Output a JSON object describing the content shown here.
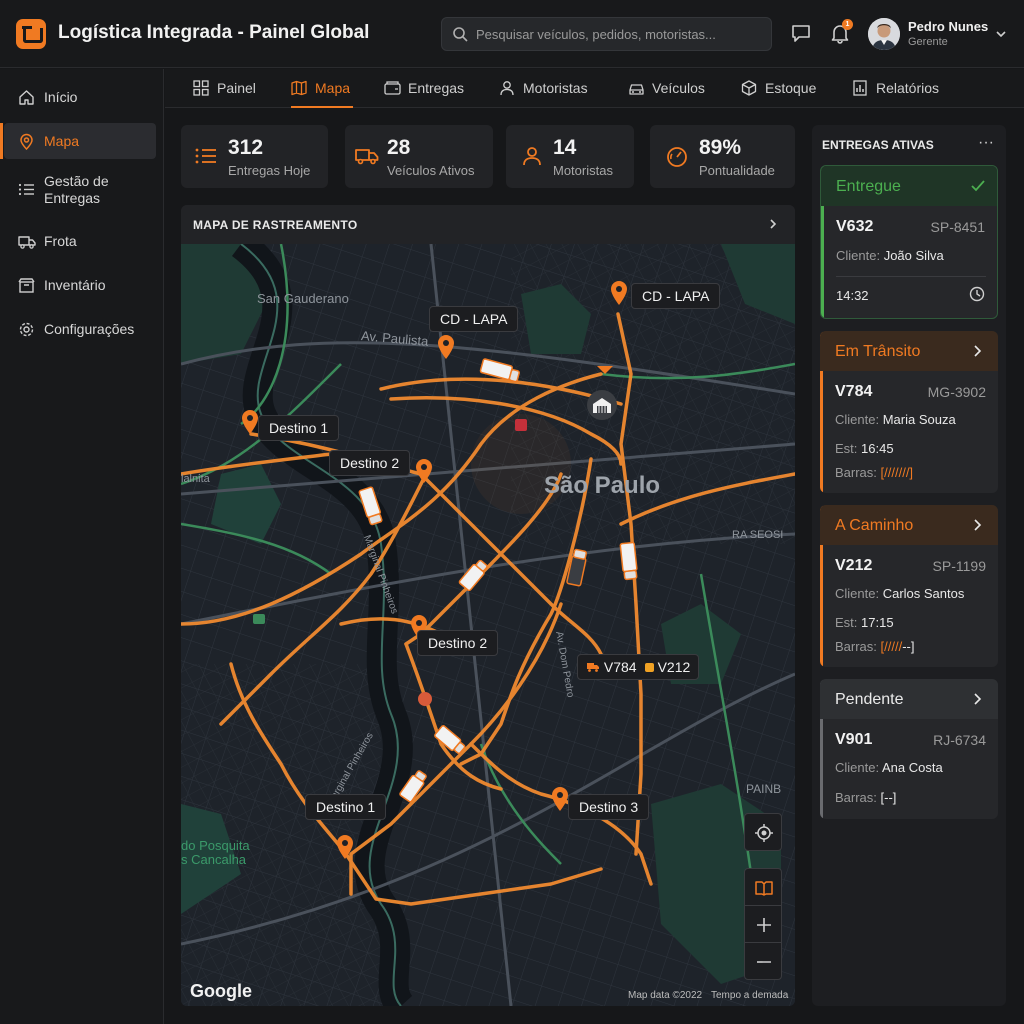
{
  "header": {
    "title": "Logística Integrada - Painel Global",
    "search_placeholder": "Pesquisar veículos, pedidos, motoristas...",
    "notification_count": "1",
    "user_name": "Pedro Nunes",
    "user_role": "Gerente"
  },
  "sidebar": {
    "items": [
      {
        "label": "Início",
        "icon": "home-icon"
      },
      {
        "label": "Mapa",
        "icon": "map-pin-icon",
        "active": true
      },
      {
        "label": "Gestão de Entregas",
        "icon": "list-icon"
      },
      {
        "label": "Frota",
        "icon": "truck-icon"
      },
      {
        "label": "Inventário",
        "icon": "box-icon"
      },
      {
        "label": "Configurações",
        "icon": "gear-icon"
      }
    ]
  },
  "tabs": [
    {
      "label": "Painel",
      "icon": "grid-icon"
    },
    {
      "label": "Mapa",
      "icon": "map-icon",
      "active": true
    },
    {
      "label": "Entregas",
      "icon": "package-icon"
    },
    {
      "label": "Motoristas",
      "icon": "user-icon"
    },
    {
      "label": "Veículos",
      "icon": "car-icon"
    },
    {
      "label": "Estoque",
      "icon": "cube-icon"
    },
    {
      "label": "Relatórios",
      "icon": "report-icon"
    }
  ],
  "stats": [
    {
      "value": "312",
      "label": "Entregas Hoje",
      "icon": "list-icon"
    },
    {
      "value": "28",
      "label": "Veículos Ativos",
      "icon": "truck-icon"
    },
    {
      "value": "14",
      "label": "Motoristas",
      "icon": "user-icon"
    },
    {
      "value": "89%",
      "label": "Pontualidade",
      "icon": "gauge-icon"
    }
  ],
  "map": {
    "title": "MAPA DE RASTREAMENTO",
    "places": {
      "san_gauderano": "San Gauderano",
      "av_paulista": "Av. Paulista",
      "sao_paulo": "São Paulo",
      "lalnita": "lalnita",
      "ra_seosi": "RA SEOSI",
      "painb": "PAINB",
      "do_posquita": "do Posquita",
      "s_cancalha": "s Cancalha",
      "marginal": "Marginal Pinheiros",
      "av_doc": "Av. Dom Pedro",
      "marginal_2": "Marginal Pinheiros"
    },
    "pins": {
      "cd_lapa_1": "CD - LAPA",
      "cd_lapa_2": "CD - LAPA",
      "destino_1a": "Destino 1",
      "destino_2a": "Destino 2",
      "destino_2b": "Destino 2",
      "destino_1b": "Destino 1",
      "destino_3": "Destino 3"
    },
    "truck_label": {
      "v1": "V784",
      "v2": "V212"
    },
    "google": "Google",
    "attribution_1": "Map data ©2022",
    "attribution_2": "Tempo a demada"
  },
  "active_deliveries": {
    "title": "ENTREGAS ATIVAS",
    "more": "···",
    "cards": [
      {
        "status": "Entregue",
        "status_color": "#4caf50",
        "vehicle": "V632",
        "plate": "SP-8451",
        "client_label": "Cliente:",
        "client": "João Silva",
        "time": "14:32"
      },
      {
        "status": "Em Trânsito",
        "status_color": "#f07a22",
        "vehicle": "V784",
        "plate": "MG-3902",
        "client_label": "Cliente:",
        "client": "Maria Souza",
        "est_label": "Est:",
        "est": "16:45",
        "bars_label": "Barras:",
        "bars": "[///////]"
      },
      {
        "status": "A Caminho",
        "status_color": "#f07a22",
        "vehicle": "V212",
        "plate": "SP-1199",
        "client_label": "Cliente:",
        "client": "Carlos Santos",
        "est_label": "Est:",
        "est": "17:15",
        "bars_label": "Barras:",
        "bars_fill": "[/////",
        "bars_rest": "--]"
      },
      {
        "status": "Pendente",
        "status_color": "#9a9a9a",
        "vehicle": "V901",
        "plate": "RJ-6734",
        "client_label": "Cliente:",
        "client": "Ana Costa",
        "bars_label": "Barras:",
        "bars": "[--]"
      }
    ]
  },
  "colors": {
    "accent": "#f07a22",
    "success": "#4caf50",
    "background": "#161719"
  }
}
